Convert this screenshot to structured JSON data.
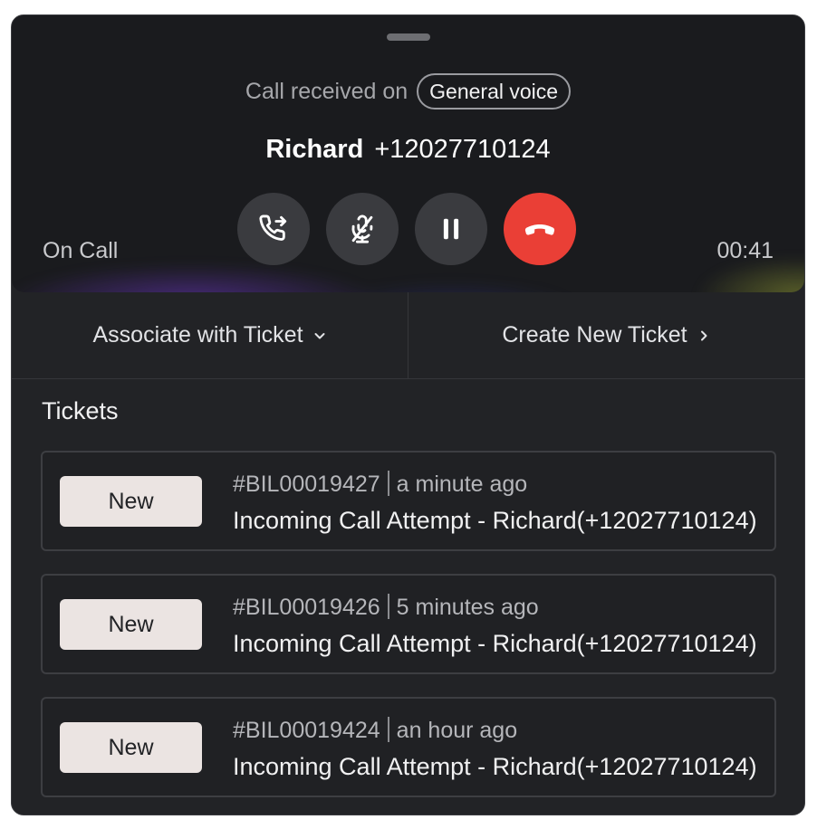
{
  "call": {
    "received_label": "Call received on",
    "channel": "General voice",
    "caller_name": "Richard",
    "caller_number": "+12027710124",
    "status": "On Call",
    "timer": "00:41",
    "controls": [
      {
        "name": "transfer-button",
        "icon": "phone-transfer-icon"
      },
      {
        "name": "mute-button",
        "icon": "mic-off-icon"
      },
      {
        "name": "hold-button",
        "icon": "pause-icon"
      },
      {
        "name": "end-call-button",
        "icon": "phone-hangup-icon"
      }
    ],
    "end_call_color": "#ea3f36"
  },
  "actions": {
    "associate_label": "Associate with Ticket",
    "create_label": "Create New Ticket"
  },
  "tickets": {
    "title": "Tickets",
    "items": [
      {
        "status": "New",
        "id": "#BIL00019427",
        "time": "a minute ago",
        "subject": "Incoming Call Attempt - Richard(+12027710124)"
      },
      {
        "status": "New",
        "id": "#BIL00019426",
        "time": "5 minutes ago",
        "subject": "Incoming Call Attempt - Richard(+12027710124)"
      },
      {
        "status": "New",
        "id": "#BIL00019424",
        "time": "an hour ago",
        "subject": "Incoming Call Attempt - Richard(+12027710124)"
      }
    ]
  }
}
